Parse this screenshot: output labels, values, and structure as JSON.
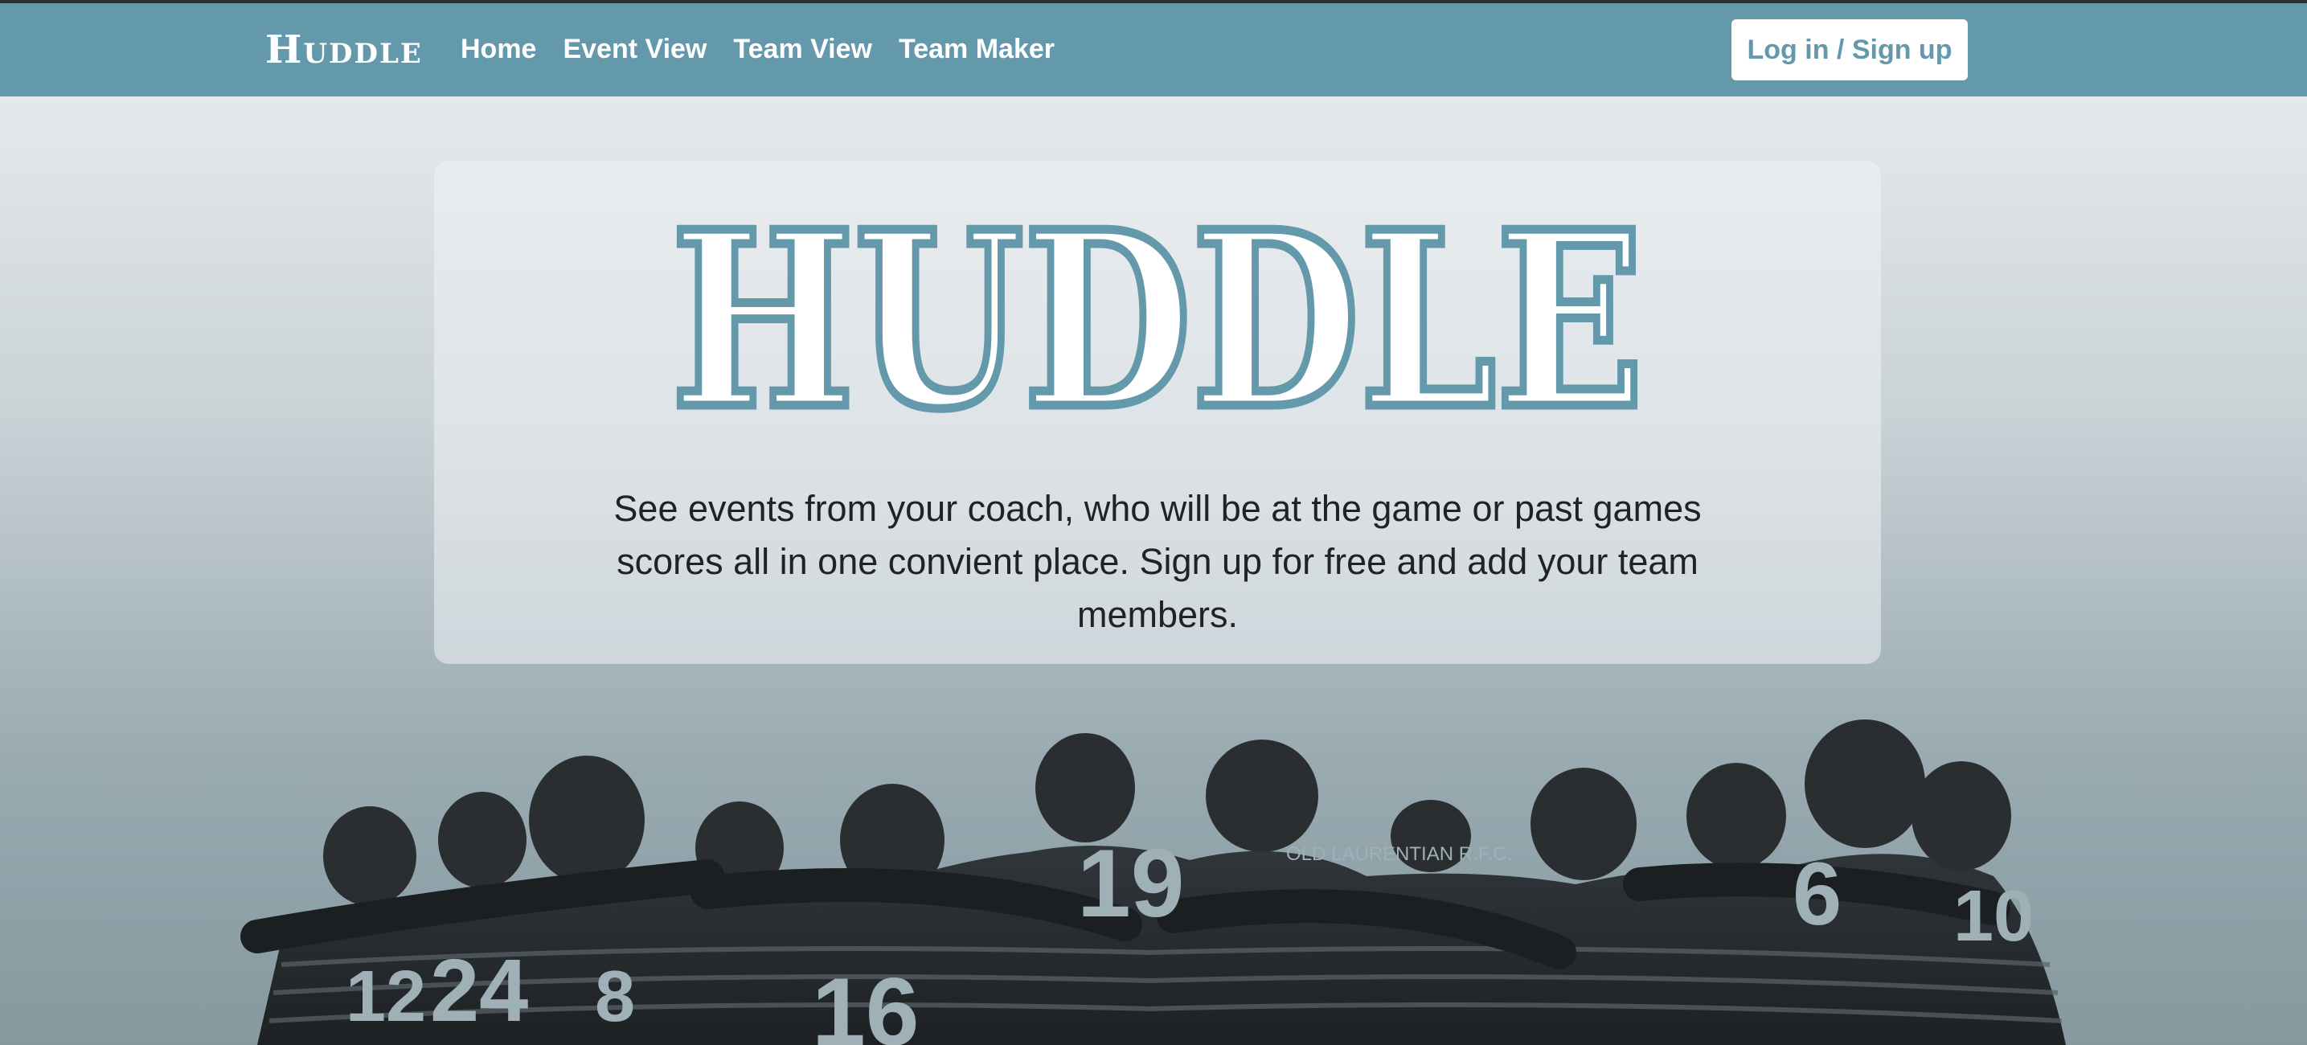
{
  "navbar": {
    "brand": "Huddle",
    "links": [
      {
        "label": "Home"
      },
      {
        "label": "Event View"
      },
      {
        "label": "Team View"
      },
      {
        "label": "Team Maker"
      }
    ],
    "login_label": "Log in / Sign up"
  },
  "hero": {
    "logo_text": "HUDDLE",
    "description": "See events from your coach, who will be at the game or past games scores all in one convient place. Sign up for free and add your team members."
  },
  "photo": {
    "jersey_numbers": [
      "12",
      "24",
      "8",
      "16",
      "19",
      "6",
      "10"
    ],
    "hoodie_text": "OLD LAURENTIAN R.F.C."
  },
  "colors": {
    "accent": "#6399aa",
    "navbar_bg": "#6399aa",
    "text_dark": "#1f2326",
    "white": "#ffffff"
  }
}
